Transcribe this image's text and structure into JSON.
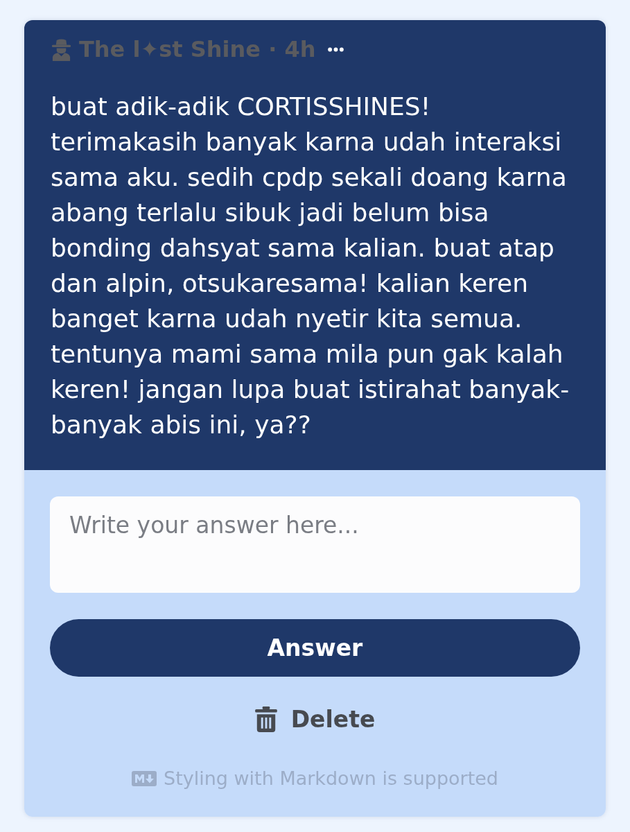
{
  "post": {
    "author": "The l✦st Shine",
    "separator": "·",
    "time": "4h",
    "text": "buat adik-adik CORTISSHINES!\nterimakasih banyak karna udah interaksi sama aku. sedih cpdp sekali doang karna abang terlalu sibuk jadi belum bisa bonding dahsyat sama kalian. buat atap dan alpin, otsukaresama! kalian keren banget karna udah nyetir kita semua. tentunya mami sama mila pun gak kalah keren! jangan lupa buat istirahat banyak-banyak abis ini, ya??"
  },
  "answer_field": {
    "placeholder": "Write your answer here..."
  },
  "answer_button": {
    "label": "Answer"
  },
  "delete_button": {
    "label": "Delete"
  },
  "markdown_note": {
    "text": "Styling with Markdown is supported"
  }
}
